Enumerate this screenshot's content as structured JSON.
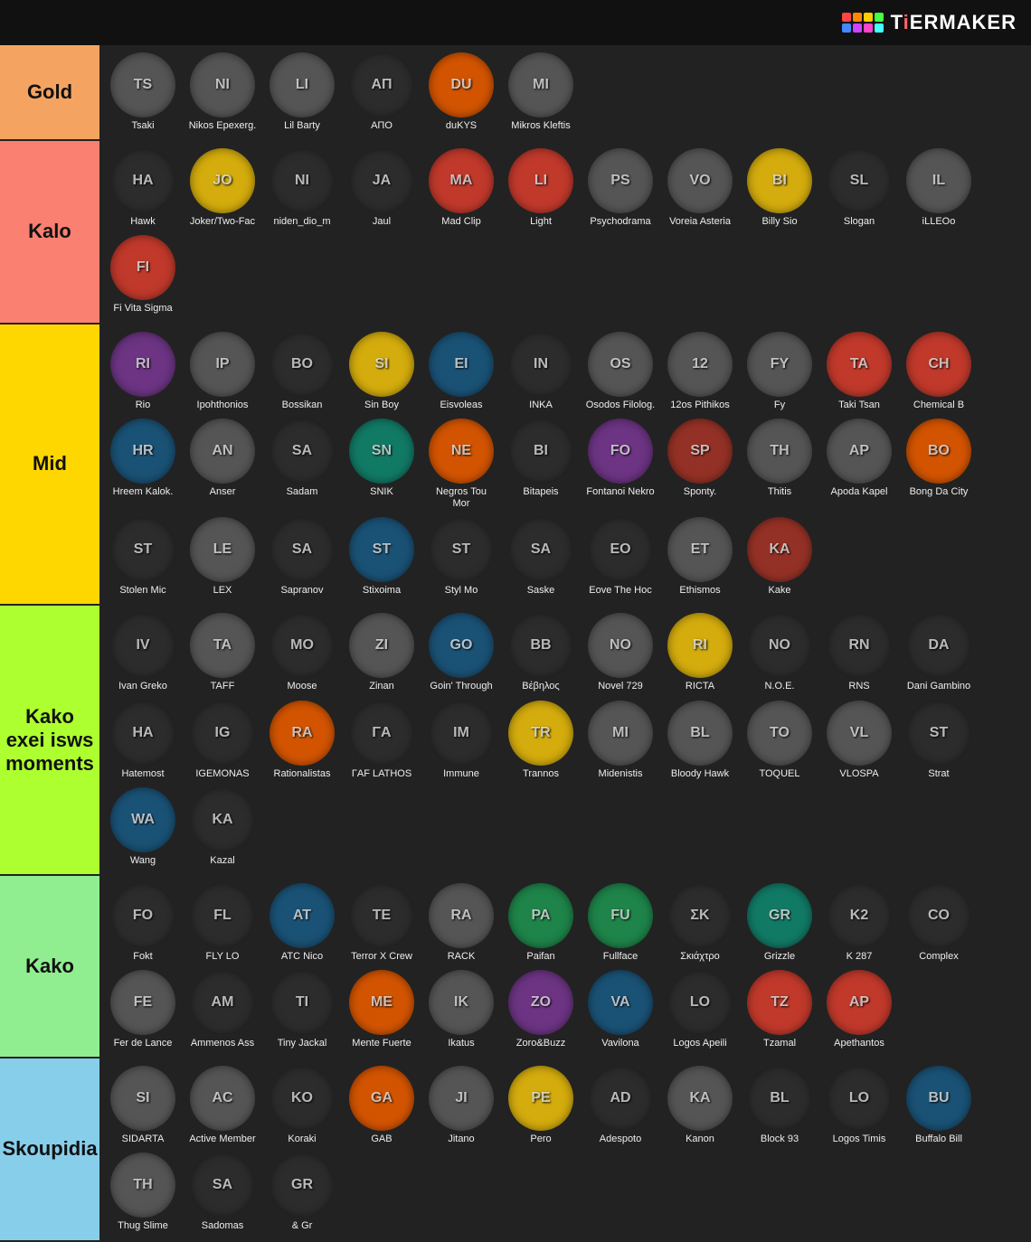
{
  "header": {
    "logo_text": "TiERMAKER",
    "logo_colors": [
      "#ff4444",
      "#ff8800",
      "#ffcc00",
      "#44ff44",
      "#4488ff",
      "#cc44ff",
      "#ff44cc",
      "#44ffff"
    ]
  },
  "tiers": [
    {
      "id": "gold",
      "label": "Gold",
      "color": "#f4a460",
      "artists": [
        {
          "name": "Tsaki",
          "color": "av-gray"
        },
        {
          "name": "Nikos Epexerg.",
          "color": "av-gray"
        },
        {
          "name": "Lil Barty",
          "color": "av-gray"
        },
        {
          "name": "ΑΠΟ",
          "color": "av-dark"
        },
        {
          "name": "duKYS",
          "color": "av-orange"
        },
        {
          "name": "Mikros Kleftis",
          "color": "av-gray"
        }
      ]
    },
    {
      "id": "kalo",
      "label": "Kalo",
      "color": "#fa8072",
      "artists": [
        {
          "name": "Hawk",
          "color": "av-dark"
        },
        {
          "name": "Joker/Two-Fac",
          "color": "av-yellow"
        },
        {
          "name": "niden_dio_m",
          "color": "av-dark"
        },
        {
          "name": "Jaul",
          "color": "av-dark"
        },
        {
          "name": "Mad Clip",
          "color": "av-red"
        },
        {
          "name": "Light",
          "color": "av-red"
        },
        {
          "name": "Psychodrama",
          "color": "av-gray"
        },
        {
          "name": "Voreia Asteria",
          "color": "av-gray"
        },
        {
          "name": "Billy Sio",
          "color": "av-yellow"
        },
        {
          "name": "Slogan",
          "color": "av-dark"
        },
        {
          "name": "iLLEOo",
          "color": "av-gray"
        },
        {
          "name": "Fi Vita Sigma",
          "color": "av-red"
        }
      ]
    },
    {
      "id": "mid",
      "label": "Mid",
      "color": "#ffd700",
      "artists": [
        {
          "name": "Rio",
          "color": "av-purple"
        },
        {
          "name": "Ipohthonios",
          "color": "av-gray"
        },
        {
          "name": "Bossikan",
          "color": "av-dark"
        },
        {
          "name": "Sin Boy",
          "color": "av-yellow"
        },
        {
          "name": "Eisvoleas",
          "color": "av-blue"
        },
        {
          "name": "INKA",
          "color": "av-dark"
        },
        {
          "name": "Osodos Filolog.",
          "color": "av-gray"
        },
        {
          "name": "12os Pithikos",
          "color": "av-gray"
        },
        {
          "name": "Fy",
          "color": "av-gray"
        },
        {
          "name": "Taki Tsan",
          "color": "av-red"
        },
        {
          "name": "Chemical B",
          "color": "av-red"
        },
        {
          "name": "Hreem Kalok.",
          "color": "av-blue"
        },
        {
          "name": "Anser",
          "color": "av-gray"
        },
        {
          "name": "Sadam",
          "color": "av-dark"
        },
        {
          "name": "SNIK",
          "color": "av-teal"
        },
        {
          "name": "Negros Tou Mor",
          "color": "av-orange"
        },
        {
          "name": "Bitapeis",
          "color": "av-dark"
        },
        {
          "name": "Fontanoi Nekro",
          "color": "av-purple"
        },
        {
          "name": "Sponty.",
          "color": "av-pink"
        },
        {
          "name": "Thitis",
          "color": "av-gray"
        },
        {
          "name": "Apoda Kapel",
          "color": "av-gray"
        },
        {
          "name": "Bong Da City",
          "color": "av-orange"
        },
        {
          "name": "Stolen Mic",
          "color": "av-dark"
        },
        {
          "name": "LEX",
          "color": "av-gray"
        },
        {
          "name": "Sapranov",
          "color": "av-dark"
        },
        {
          "name": "Stixoima",
          "color": "av-blue"
        },
        {
          "name": "Styl Mo",
          "color": "av-dark"
        },
        {
          "name": "Saske",
          "color": "av-dark"
        },
        {
          "name": "Εove The Hoc",
          "color": "av-dark"
        },
        {
          "name": "Ethismos",
          "color": "av-gray"
        },
        {
          "name": "Kake",
          "color": "av-pink"
        }
      ]
    },
    {
      "id": "kako-exei",
      "label": "Kako exei isws moments",
      "color": "#adff2f",
      "artists": [
        {
          "name": "Ivan Greko",
          "color": "av-dark"
        },
        {
          "name": "TAFF",
          "color": "av-gray"
        },
        {
          "name": "Moose",
          "color": "av-dark"
        },
        {
          "name": "Zinan",
          "color": "av-gray"
        },
        {
          "name": "Goin' Through",
          "color": "av-blue"
        },
        {
          "name": "Βέβηλος",
          "color": "av-dark"
        },
        {
          "name": "Novel 729",
          "color": "av-gray"
        },
        {
          "name": "RICTA",
          "color": "av-yellow"
        },
        {
          "name": "N.O.E.",
          "color": "av-dark"
        },
        {
          "name": "RNS",
          "color": "av-dark"
        },
        {
          "name": "Dani Gambino",
          "color": "av-dark"
        },
        {
          "name": "Hatemost",
          "color": "av-dark"
        },
        {
          "name": "IGEMONAS",
          "color": "av-dark"
        },
        {
          "name": "Rationalistas",
          "color": "av-orange"
        },
        {
          "name": "ΓAF LATHOS",
          "color": "av-dark"
        },
        {
          "name": "Immune",
          "color": "av-dark"
        },
        {
          "name": "Trannos",
          "color": "av-yellow"
        },
        {
          "name": "Midenistis",
          "color": "av-gray"
        },
        {
          "name": "Bloody Hawk",
          "color": "av-gray"
        },
        {
          "name": "TOQUEL",
          "color": "av-gray"
        },
        {
          "name": "VLOSPA",
          "color": "av-gray"
        },
        {
          "name": "Strat",
          "color": "av-dark"
        },
        {
          "name": "Wang",
          "color": "av-blue"
        },
        {
          "name": "Kazal",
          "color": "av-dark"
        }
      ]
    },
    {
      "id": "kako",
      "label": "Kako",
      "color": "#90ee90",
      "artists": [
        {
          "name": "Fokt",
          "color": "av-dark"
        },
        {
          "name": "FLY LO",
          "color": "av-dark"
        },
        {
          "name": "ATC Nico",
          "color": "av-blue"
        },
        {
          "name": "Terror X Crew",
          "color": "av-dark"
        },
        {
          "name": "RACK",
          "color": "av-gray"
        },
        {
          "name": "Paifan",
          "color": "av-green"
        },
        {
          "name": "Fullface",
          "color": "av-green"
        },
        {
          "name": "Σκιάχτρο",
          "color": "av-dark"
        },
        {
          "name": "Grizzle",
          "color": "av-teal"
        },
        {
          "name": "K 287",
          "color": "av-dark"
        },
        {
          "name": "Complex",
          "color": "av-dark"
        },
        {
          "name": "Fer de Lance",
          "color": "av-gray"
        },
        {
          "name": "Ammenos Ass",
          "color": "av-dark"
        },
        {
          "name": "Tiny Jackal",
          "color": "av-dark"
        },
        {
          "name": "Mente Fuerte",
          "color": "av-orange"
        },
        {
          "name": "Ikatus",
          "color": "av-gray"
        },
        {
          "name": "Zoro&Buzz",
          "color": "av-purple"
        },
        {
          "name": "Vavilona",
          "color": "av-blue"
        },
        {
          "name": "Logos Apeili",
          "color": "av-dark"
        },
        {
          "name": "Tzamal",
          "color": "av-red"
        },
        {
          "name": "Apethantos",
          "color": "av-red"
        }
      ]
    },
    {
      "id": "skoupidia",
      "label": "Skoupidia",
      "color": "#87ceeb",
      "artists": [
        {
          "name": "SIDARTA",
          "color": "av-gray"
        },
        {
          "name": "Active Member",
          "color": "av-gray"
        },
        {
          "name": "Koraki",
          "color": "av-dark"
        },
        {
          "name": "GAB",
          "color": "av-orange"
        },
        {
          "name": "Jitano",
          "color": "av-gray"
        },
        {
          "name": "Pero",
          "color": "av-yellow"
        },
        {
          "name": "Adespoto",
          "color": "av-dark"
        },
        {
          "name": "Kanon",
          "color": "av-gray"
        },
        {
          "name": "Block 93",
          "color": "av-dark"
        },
        {
          "name": "Logos Timis",
          "color": "av-dark"
        },
        {
          "name": "Buffalo Bill",
          "color": "av-blue"
        },
        {
          "name": "Thug Slime",
          "color": "av-gray"
        },
        {
          "name": "Sadomas",
          "color": "av-dark"
        },
        {
          "name": "& Gr",
          "color": "av-dark"
        }
      ]
    }
  ]
}
